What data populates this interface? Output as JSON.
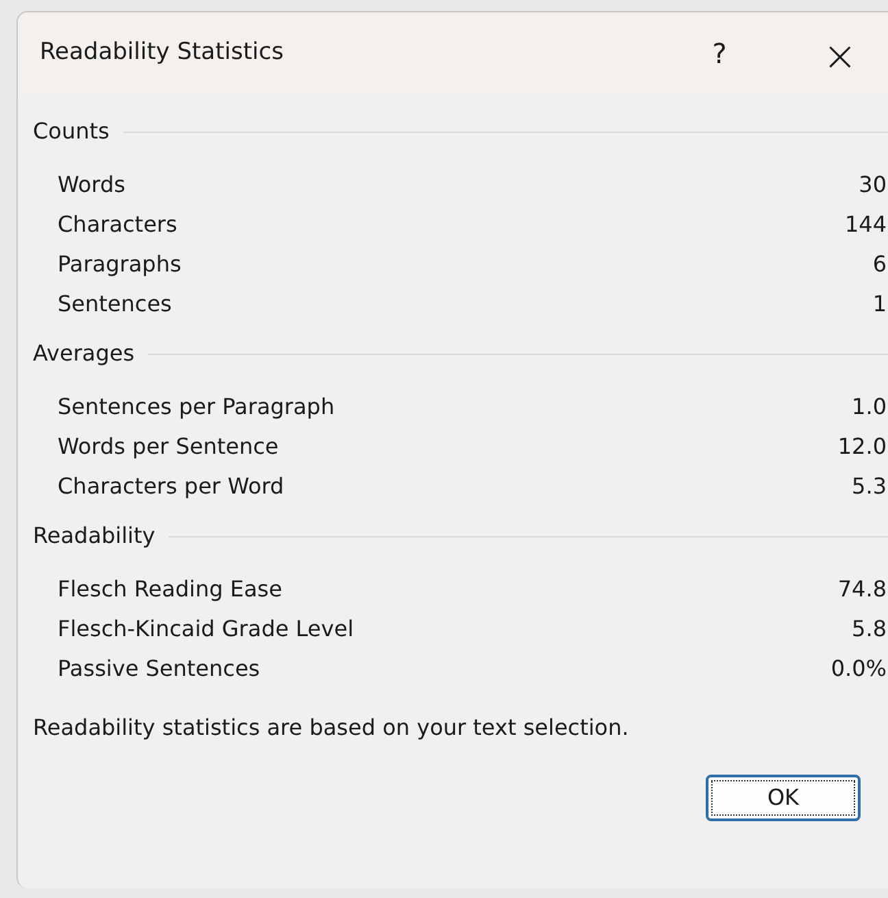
{
  "window": {
    "title": "Readability Statistics",
    "help_glyph": "?",
    "close_glyph": "×"
  },
  "sections": [
    {
      "title": "Counts",
      "rows": [
        {
          "label": "Words",
          "value": "30"
        },
        {
          "label": "Characters",
          "value": "144"
        },
        {
          "label": "Paragraphs",
          "value": "6"
        },
        {
          "label": "Sentences",
          "value": "1"
        }
      ]
    },
    {
      "title": "Averages",
      "rows": [
        {
          "label": "Sentences per Paragraph",
          "value": "1.0"
        },
        {
          "label": "Words per Sentence",
          "value": "12.0"
        },
        {
          "label": "Characters per Word",
          "value": "5.3"
        }
      ]
    },
    {
      "title": "Readability",
      "rows": [
        {
          "label": "Flesch Reading Ease",
          "value": "74.8"
        },
        {
          "label": "Flesch-Kincaid Grade Level",
          "value": "5.8"
        },
        {
          "label": "Passive Sentences",
          "value": "0.0%"
        }
      ]
    }
  ],
  "note": "Readability statistics are based on your text selection.",
  "buttons": [
    "OK"
  ]
}
